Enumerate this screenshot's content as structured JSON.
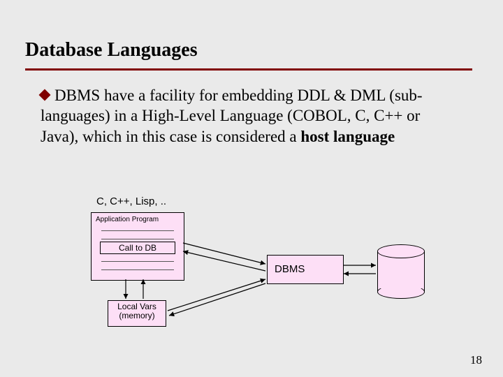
{
  "title": "Database Languages",
  "bullet_parts": {
    "p1": "DBMS have a facility for embedding DDL & DML (sub-languages) in a High-Level Language (COBOL, C, C++ or Java), which in this case is considered a ",
    "p2": "host language"
  },
  "diagram": {
    "lang_label": "C, C++, Lisp, ..",
    "app_title": "Application Program",
    "call_db": "Call to DB",
    "local_vars_l1": "Local Vars",
    "local_vars_l2": "(memory)",
    "dbms": "DBMS"
  },
  "page_number": "18"
}
